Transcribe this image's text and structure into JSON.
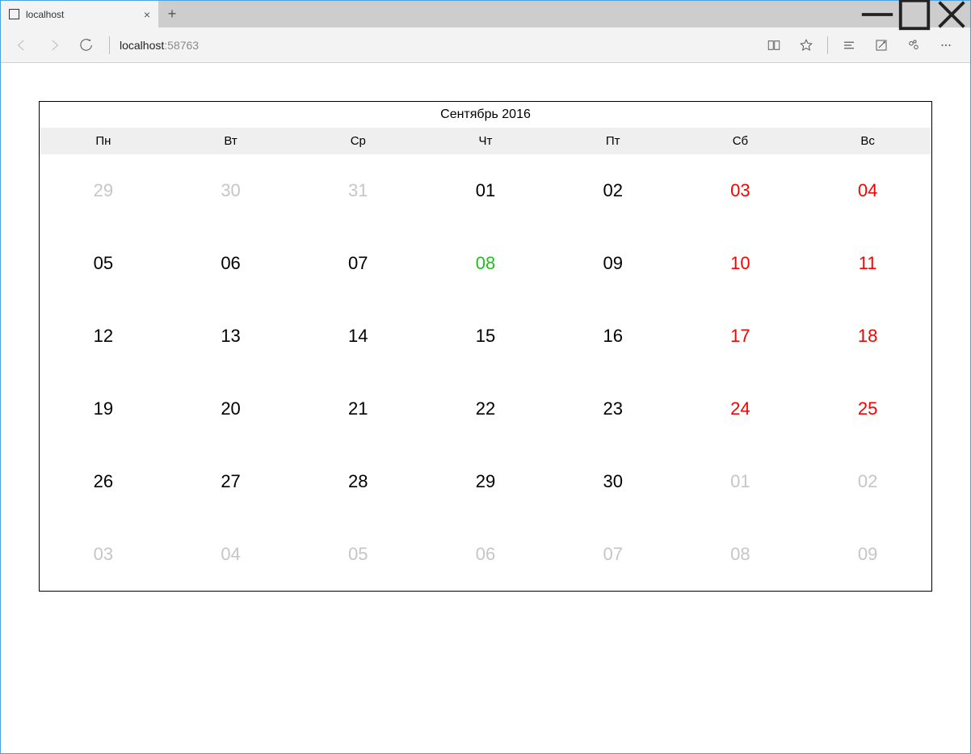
{
  "browser": {
    "tab_title": "localhost",
    "address_host": "localhost",
    "address_port": ":58763"
  },
  "calendar": {
    "title": "Сентябрь 2016",
    "weekdays": [
      "Пн",
      "Вт",
      "Ср",
      "Чт",
      "Пт",
      "Сб",
      "Вс"
    ],
    "days": [
      {
        "d": "29",
        "muted": true
      },
      {
        "d": "30",
        "muted": true
      },
      {
        "d": "31",
        "muted": true
      },
      {
        "d": "01"
      },
      {
        "d": "02"
      },
      {
        "d": "03",
        "weekend": true
      },
      {
        "d": "04",
        "weekend": true
      },
      {
        "d": "05"
      },
      {
        "d": "06"
      },
      {
        "d": "07"
      },
      {
        "d": "08",
        "today": true
      },
      {
        "d": "09"
      },
      {
        "d": "10",
        "weekend": true
      },
      {
        "d": "11",
        "weekend": true
      },
      {
        "d": "12"
      },
      {
        "d": "13"
      },
      {
        "d": "14"
      },
      {
        "d": "15"
      },
      {
        "d": "16"
      },
      {
        "d": "17",
        "weekend": true
      },
      {
        "d": "18",
        "weekend": true
      },
      {
        "d": "19"
      },
      {
        "d": "20"
      },
      {
        "d": "21"
      },
      {
        "d": "22"
      },
      {
        "d": "23"
      },
      {
        "d": "24",
        "weekend": true
      },
      {
        "d": "25",
        "weekend": true
      },
      {
        "d": "26"
      },
      {
        "d": "27"
      },
      {
        "d": "28"
      },
      {
        "d": "29"
      },
      {
        "d": "30"
      },
      {
        "d": "01",
        "muted": true
      },
      {
        "d": "02",
        "muted": true
      },
      {
        "d": "03",
        "muted": true
      },
      {
        "d": "04",
        "muted": true
      },
      {
        "d": "05",
        "muted": true
      },
      {
        "d": "06",
        "muted": true
      },
      {
        "d": "07",
        "muted": true
      },
      {
        "d": "08",
        "muted": true
      },
      {
        "d": "09",
        "muted": true
      }
    ]
  }
}
